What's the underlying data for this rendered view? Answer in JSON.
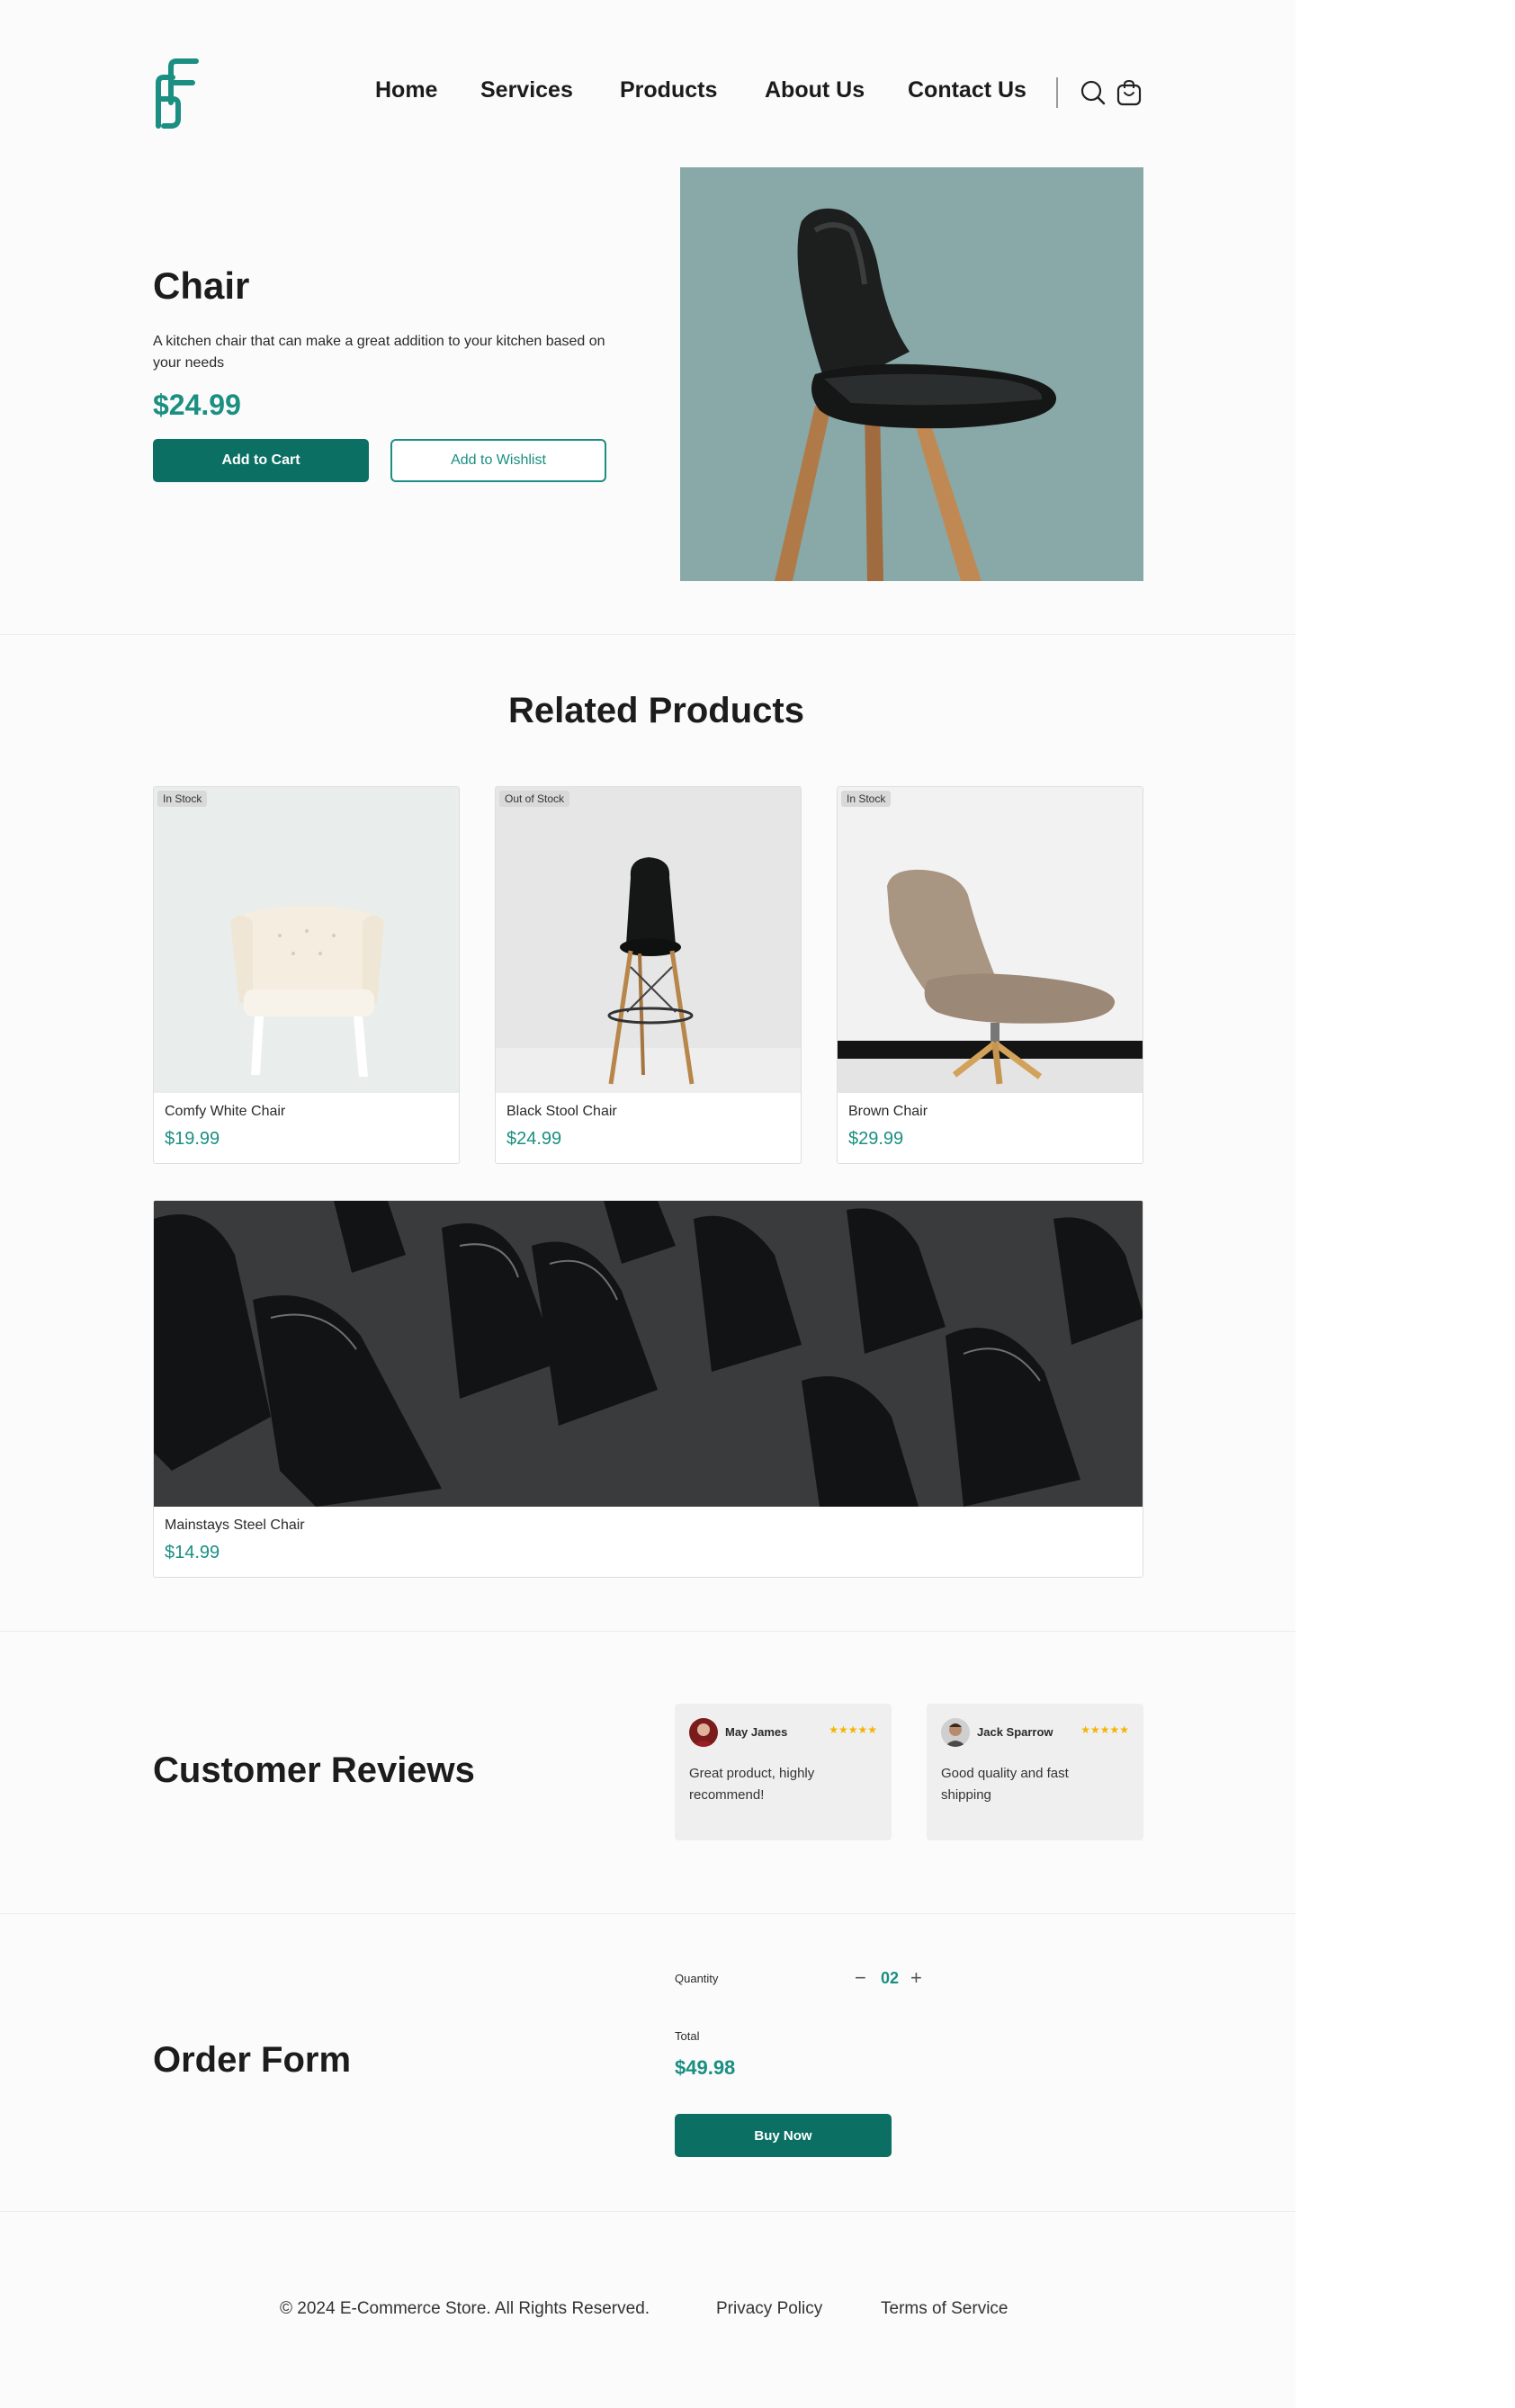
{
  "nav": {
    "items": [
      {
        "label": "Home"
      },
      {
        "label": "Services"
      },
      {
        "label": "Products"
      },
      {
        "label": "About Us"
      },
      {
        "label": "Contact Us"
      }
    ],
    "icons": [
      "search-icon",
      "cart-icon"
    ]
  },
  "hero": {
    "title": "Chair",
    "description": "A kitchen chair that can make a great addition to your kitchen based on your needs",
    "price": "$24.99",
    "add_to_cart": "Add to Cart",
    "add_to_wishlist": "Add to Wishlist"
  },
  "related": {
    "title": "Related Products",
    "products": [
      {
        "name": "Comfy White Chair",
        "price": "$19.99",
        "status": "In Stock"
      },
      {
        "name": "Black Stool Chair",
        "price": "$24.99",
        "status": "Out of Stock"
      },
      {
        "name": "Brown Chair",
        "price": "$29.99",
        "status": "In Stock"
      },
      {
        "name": "Mainstays Steel  Chair",
        "price": "$14.99",
        "status": ""
      }
    ]
  },
  "reviews": {
    "title": "Customer Reviews",
    "items": [
      {
        "name": "May James",
        "rating": 5,
        "stars": "★★★★★",
        "text": "Great product, highly recommend!"
      },
      {
        "name": "Jack Sparrow",
        "rating": 5,
        "stars": "★★★★★",
        "text": "Good quality and fast shipping"
      }
    ]
  },
  "order": {
    "title": "Order Form",
    "quantity_label": "Quantity",
    "quantity": "02",
    "minus": "−",
    "plus": "+",
    "total_label": "Total",
    "total": "$49.98",
    "buy_now": "Buy Now"
  },
  "footer": {
    "copyright": "© 2024 E-Commerce Store. All Rights Reserved.",
    "privacy": "Privacy Policy",
    "terms": "Terms of Service"
  },
  "colors": {
    "accent": "#1a8f82",
    "primary_button": "#0b6f63",
    "hero_bg": "#88a9a8",
    "star": "#f4b400"
  }
}
